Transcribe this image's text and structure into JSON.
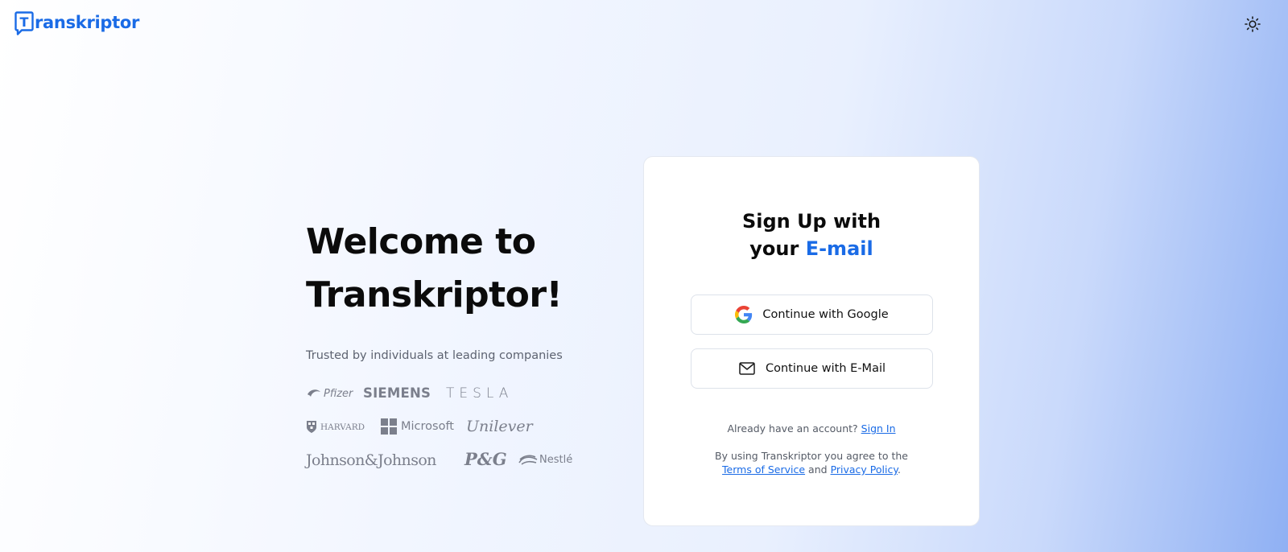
{
  "header": {
    "logo_text": "ranskriptor",
    "logo_letter": "T",
    "brand_color": "#1a6be6",
    "theme_toggle_icon": "sun-icon"
  },
  "hero": {
    "title": "Welcome to\nTranskriptor!",
    "trusted_text": "Trusted by individuals at leading companies",
    "companies": [
      "Pfizer",
      "SIEMENS",
      "TESLA",
      "HARVARD",
      "Microsoft",
      "Unilever",
      "Johnson&Johnson",
      "P&G",
      "Nestlé"
    ]
  },
  "signup": {
    "title_line1": "Sign Up with",
    "title_prefix": "your ",
    "title_accent": "E-mail",
    "google_button": "Continue with Google",
    "email_button": "Continue with E-Mail",
    "have_account": "Already have an account?",
    "sign_in": "Sign In",
    "agree_text": "By using Transkriptor you agree to the",
    "terms": "Terms of Service",
    "and": "and",
    "privacy": "Privacy Policy",
    "period": "."
  }
}
